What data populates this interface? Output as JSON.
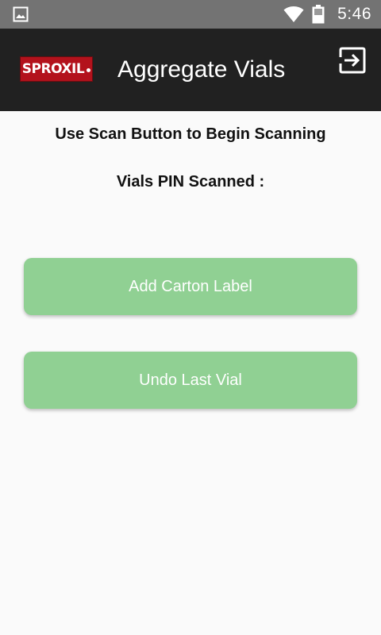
{
  "status_bar": {
    "time": "5:46",
    "icons": [
      "gallery-icon",
      "wifi-icon",
      "battery-icon"
    ]
  },
  "app_bar": {
    "logo_text": "SPROXIL",
    "title": "Aggregate Vials",
    "exit_icon": "exit-icon"
  },
  "main": {
    "instruction": "Use Scan Button to Begin Scanning",
    "scanned_label": "Vials PIN Scanned :",
    "buttons": {
      "add_carton": "Add Carton Label",
      "undo_last": "Undo Last Vial"
    }
  },
  "colors": {
    "status_bar": "#737373",
    "app_bar": "#212121",
    "button": "#90d093",
    "logo": "#b3121c"
  }
}
